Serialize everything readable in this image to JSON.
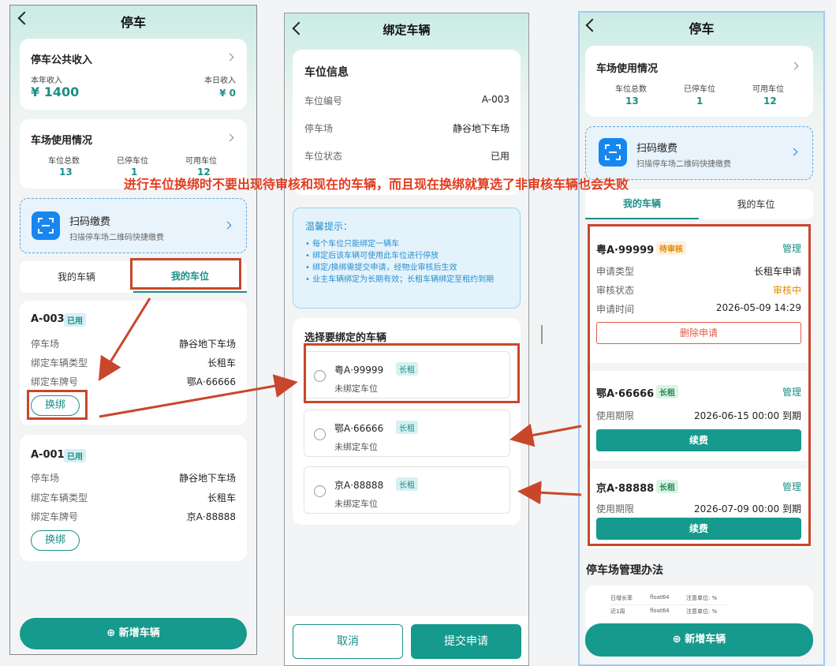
{
  "annotation": "进行车位换绑时不要出现待审核和现在的车辆，而且现在换绑就算选了非审核车辆也会失败",
  "left": {
    "title": "停车",
    "income": {
      "title": "停车公共收入",
      "year_label": "本年收入",
      "year_value": "¥ 1400",
      "day_label": "本日收入",
      "day_value": "¥ 0"
    },
    "usage": {
      "title": "车场使用情况",
      "total_label": "车位总数",
      "total": "13",
      "used_label": "已停车位",
      "used": "1",
      "avail_label": "可用车位",
      "avail": "12"
    },
    "scan": {
      "title": "扫码缴费",
      "subtitle": "扫描停车场二维码快捷缴费"
    },
    "tabs": [
      "我的车辆",
      "我的车位"
    ],
    "spots": [
      {
        "id": "A-003",
        "status": "已用",
        "lot_label": "停车场",
        "lot": "静谷地下车场",
        "type_label": "绑定车辆类型",
        "type": "长租车",
        "plate_label": "绑定车牌号",
        "plate": "鄂A·66666",
        "btn": "换绑"
      },
      {
        "id": "A-001",
        "status": "已用",
        "lot_label": "停车场",
        "lot": "静谷地下车场",
        "type_label": "绑定车辆类型",
        "type": "长租车",
        "plate_label": "绑定车牌号",
        "plate": "京A·88888",
        "btn": "换绑"
      }
    ],
    "add_btn": "新增车辆"
  },
  "middle": {
    "title": "绑定车辆",
    "info": {
      "title": "车位信息",
      "rows": [
        {
          "label": "车位编号",
          "value": "A-003"
        },
        {
          "label": "停车场",
          "value": "静谷地下车场"
        },
        {
          "label": "车位状态",
          "value": "已用"
        }
      ]
    },
    "tips": {
      "title": "温馨提示：",
      "items": [
        "每个车位只能绑定一辆车",
        "绑定后该车辆可使用此车位进行停放",
        "绑定/换绑需提交申请，经物业审核后生效",
        "业主车辆绑定为长期有效；长租车辆绑定至租约到期"
      ]
    },
    "select_title": "选择要绑定的车辆",
    "vehicles": [
      {
        "plate": "粤A·99999",
        "tag": "长租",
        "sub": "未绑定车位"
      },
      {
        "plate": "鄂A·66666",
        "tag": "长租",
        "sub": "未绑定车位"
      },
      {
        "plate": "京A·88888",
        "tag": "长租",
        "sub": "未绑定车位"
      }
    ],
    "cancel": "取消",
    "submit": "提交申请"
  },
  "right": {
    "title": "停车",
    "usage": {
      "title": "车场使用情况",
      "total_label": "车位总数",
      "total": "13",
      "used_label": "已停车位",
      "used": "1",
      "avail_label": "可用车位",
      "avail": "12"
    },
    "scan": {
      "title": "扫码缴费",
      "subtitle": "扫描停车场二维码快捷缴费"
    },
    "tabs": [
      "我的车辆",
      "我的车位"
    ],
    "pending": {
      "plate": "粤A·99999",
      "tag": "待审核",
      "manage": "管理",
      "rows": [
        {
          "label": "申请类型",
          "value": "长租车申请"
        },
        {
          "label": "审核状态",
          "value": "审核中"
        },
        {
          "label": "申请时间",
          "value": "2026-05-09 14:29"
        }
      ],
      "delete": "删除申请"
    },
    "cars": [
      {
        "plate": "鄂A·66666",
        "tag": "长租",
        "manage": "管理",
        "period_label": "使用期限",
        "period": "2026-06-15 00:00 到期",
        "renew": "续费"
      },
      {
        "plate": "京A·88888",
        "tag": "长租",
        "manage": "管理",
        "period_label": "使用期限",
        "period": "2026-07-09 00:00 到期",
        "renew": "续费"
      }
    ],
    "rules_title": "停车场管理办法",
    "rules_table": [
      [
        "日增长率",
        "float64",
        "注意单位: %"
      ],
      [
        "近1周",
        "float64",
        "注意单位: %"
      ]
    ],
    "add_btn": "新增车辆"
  },
  "colors": {
    "accent": "#159a8d",
    "annotation": "#e23c1e",
    "box": "#c8472b"
  }
}
